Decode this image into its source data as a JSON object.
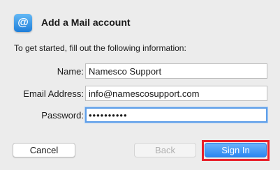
{
  "header": {
    "icon": "mail-at-icon",
    "icon_glyph": "@",
    "title": "Add a Mail account",
    "subtitle": "To get started, fill out the following information:"
  },
  "form": {
    "name": {
      "label": "Name:",
      "value": "Namesco Support"
    },
    "email": {
      "label": "Email Address:",
      "value": "info@namescosupport.com"
    },
    "password": {
      "label": "Password:",
      "value": "••••••••••"
    }
  },
  "buttons": {
    "cancel": "Cancel",
    "back": "Back",
    "sign_in": "Sign In"
  },
  "colors": {
    "accent_blue": "#2a86f0",
    "highlight_red": "#e8202a",
    "focus_ring": "#5e9ee8"
  }
}
